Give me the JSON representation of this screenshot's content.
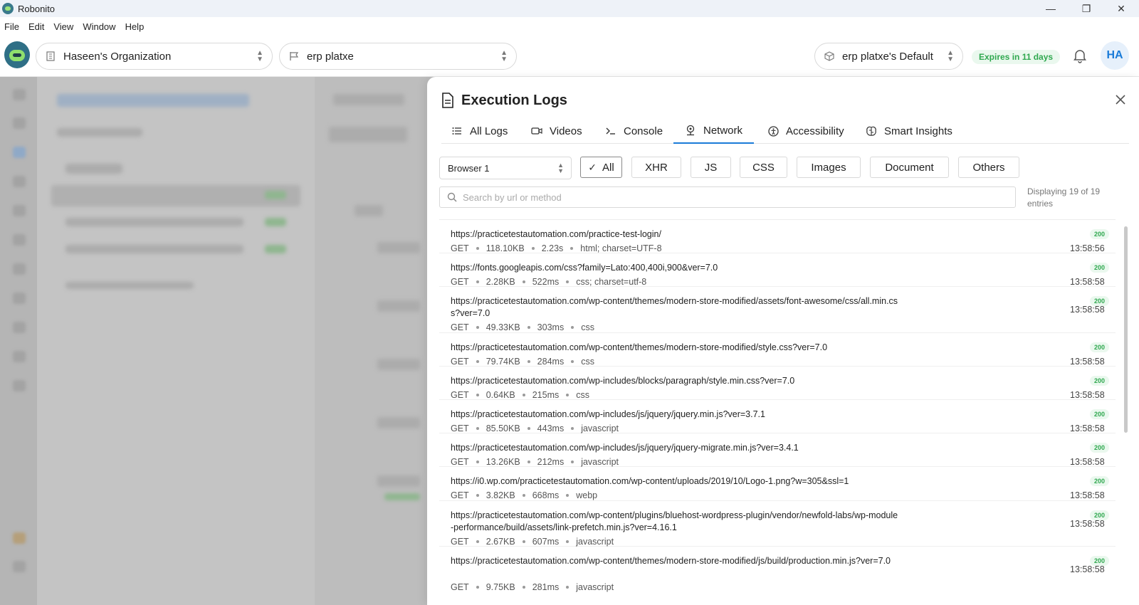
{
  "window": {
    "title": "Robonito",
    "controls": [
      "—",
      "❐",
      "✕"
    ]
  },
  "menu": [
    "File",
    "Edit",
    "View",
    "Window",
    "Help"
  ],
  "header": {
    "organization": "Haseen's Organization",
    "project": "erp platxe",
    "environment": "erp platxe's Default",
    "expires": "Expires in 11 days",
    "avatar_initials": "HA"
  },
  "drawer": {
    "title": "Execution Logs",
    "tabs": [
      {
        "label": "All Logs",
        "icon": "list-icon"
      },
      {
        "label": "Videos",
        "icon": "video-icon"
      },
      {
        "label": "Console",
        "icon": "terminal-icon"
      },
      {
        "label": "Network",
        "icon": "network-icon",
        "active": true
      },
      {
        "label": "Accessibility",
        "icon": "accessibility-icon"
      },
      {
        "label": "Smart Insights",
        "icon": "insights-icon"
      }
    ],
    "browser": "Browser 1",
    "filters": [
      "All",
      "XHR",
      "JS",
      "CSS",
      "Images",
      "Document",
      "Others"
    ],
    "active_filter": "All",
    "search_placeholder": "Search by url or method",
    "count_text": "Displaying 19 of 19 entries",
    "entries": [
      {
        "url": "https://practicetestautomation.com/practice-test-login/",
        "method": "GET",
        "size": "118.10KB",
        "duration": "2.23s",
        "type": "html; charset=UTF-8",
        "status": "200",
        "time": "13:58:56"
      },
      {
        "url": "https://fonts.googleapis.com/css?family=Lato:400,400i,900&ver=7.0",
        "method": "GET",
        "size": "2.28KB",
        "duration": "522ms",
        "type": "css; charset=utf-8",
        "status": "200",
        "time": "13:58:58"
      },
      {
        "url": "https://practicetestautomation.com/wp-content/themes/modern-store-modified/assets/font-awesome/css/all.min.css?ver=7.0",
        "method": "GET",
        "size": "49.33KB",
        "duration": "303ms",
        "type": "css",
        "status": "200",
        "time": "13:58:58"
      },
      {
        "url": "https://practicetestautomation.com/wp-content/themes/modern-store-modified/style.css?ver=7.0",
        "method": "GET",
        "size": "79.74KB",
        "duration": "284ms",
        "type": "css",
        "status": "200",
        "time": "13:58:58"
      },
      {
        "url": "https://practicetestautomation.com/wp-includes/blocks/paragraph/style.min.css?ver=7.0",
        "method": "GET",
        "size": "0.64KB",
        "duration": "215ms",
        "type": "css",
        "status": "200",
        "time": "13:58:58"
      },
      {
        "url": "https://practicetestautomation.com/wp-includes/js/jquery/jquery.min.js?ver=3.7.1",
        "method": "GET",
        "size": "85.50KB",
        "duration": "443ms",
        "type": "javascript",
        "status": "200",
        "time": "13:58:58"
      },
      {
        "url": "https://practicetestautomation.com/wp-includes/js/jquery/jquery-migrate.min.js?ver=3.4.1",
        "method": "GET",
        "size": "13.26KB",
        "duration": "212ms",
        "type": "javascript",
        "status": "200",
        "time": "13:58:58"
      },
      {
        "url": "https://i0.wp.com/practicetestautomation.com/wp-content/uploads/2019/10/Logo-1.png?w=305&ssl=1",
        "method": "GET",
        "size": "3.82KB",
        "duration": "668ms",
        "type": "webp",
        "status": "200",
        "time": "13:58:58"
      },
      {
        "url": "https://practicetestautomation.com/wp-content/plugins/bluehost-wordpress-plugin/vendor/newfold-labs/wp-module-performance/build/assets/link-prefetch.min.js?ver=4.16.1",
        "method": "GET",
        "size": "2.67KB",
        "duration": "607ms",
        "type": "javascript",
        "status": "200",
        "time": "13:58:58"
      },
      {
        "url": "https://practicetestautomation.com/wp-content/themes/modern-store-modified/js/build/production.min.js?ver=7.0",
        "method": "GET",
        "size": "9.75KB",
        "duration": "281ms",
        "type": "javascript",
        "status": "200",
        "time": "13:58:58"
      }
    ]
  }
}
